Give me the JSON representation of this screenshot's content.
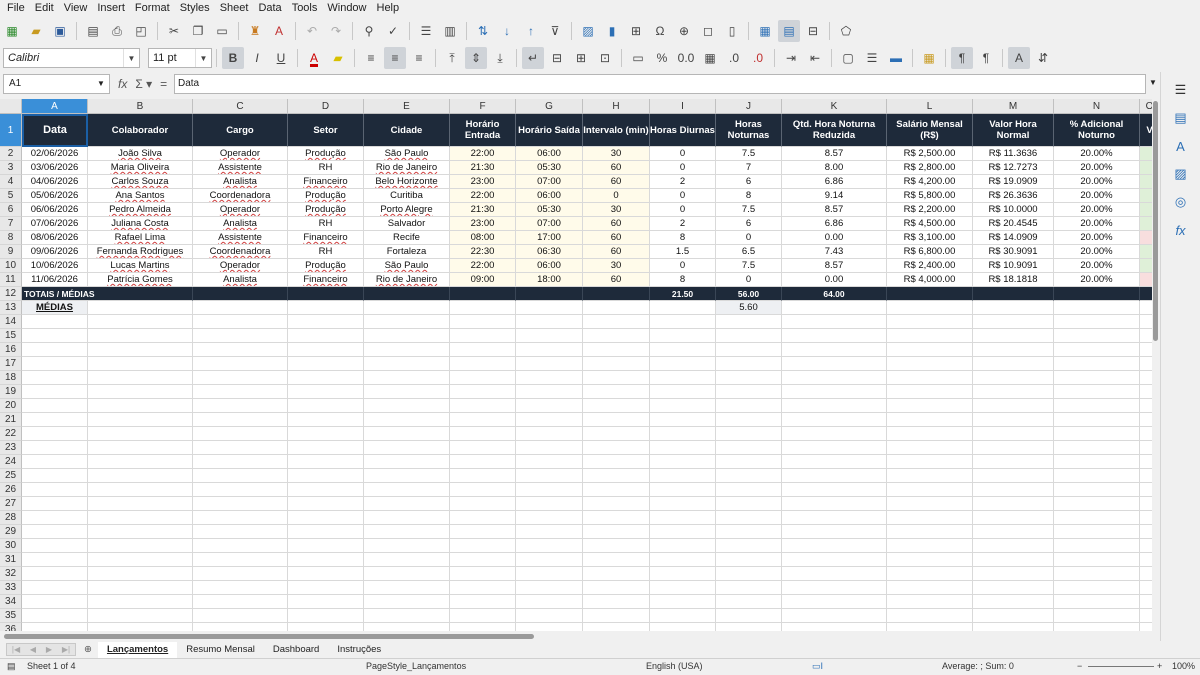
{
  "menu": [
    "File",
    "Edit",
    "View",
    "Insert",
    "Format",
    "Styles",
    "Sheet",
    "Data",
    "Tools",
    "Window",
    "Help"
  ],
  "font": {
    "name": "Calibri",
    "size": "11 pt"
  },
  "formula": {
    "cell_ref": "A1",
    "content": "Data"
  },
  "columns": [
    "A",
    "B",
    "C",
    "D",
    "E",
    "F",
    "G",
    "H",
    "I",
    "J",
    "K",
    "L",
    "M",
    "N",
    "O"
  ],
  "headers": [
    "Data",
    "Colaborador",
    "Cargo",
    "Setor",
    "Cidade",
    "Horário Entrada",
    "Horário Saída",
    "Intervalo (min)",
    "Horas Diurnas",
    "Horas Noturnas",
    "Qtd. Hora Noturna Reduzida",
    "Salário Mensal (R$)",
    "Valor Hora Normal",
    "% Adicional Noturno",
    "V"
  ],
  "rows": [
    [
      "02/06/2026",
      "João Silva",
      "Operador",
      "Produção",
      "São Paulo",
      "22:00",
      "06:00",
      "30",
      "0",
      "7.5",
      "8.57",
      "R$ 2,500.00",
      "R$ 11.3636",
      "20.00%"
    ],
    [
      "03/06/2026",
      "Maria Oliveira",
      "Assistente",
      "RH",
      "Rio de Janeiro",
      "21:30",
      "05:30",
      "60",
      "0",
      "7",
      "8.00",
      "R$ 2,800.00",
      "R$ 12.7273",
      "20.00%"
    ],
    [
      "04/06/2026",
      "Carlos Souza",
      "Analista",
      "Financeiro",
      "Belo Horizonte",
      "23:00",
      "07:00",
      "60",
      "2",
      "6",
      "6.86",
      "R$ 4,200.00",
      "R$ 19.0909",
      "20.00%"
    ],
    [
      "05/06/2026",
      "Ana Santos",
      "Coordenadora",
      "Produção",
      "Curitiba",
      "22:00",
      "06:00",
      "0",
      "0",
      "8",
      "9.14",
      "R$ 5,800.00",
      "R$ 26.3636",
      "20.00%"
    ],
    [
      "06/06/2026",
      "Pedro Almeida",
      "Operador",
      "Produção",
      "Porto Alegre",
      "21:30",
      "05:30",
      "30",
      "0",
      "7.5",
      "8.57",
      "R$ 2,200.00",
      "R$ 10.0000",
      "20.00%"
    ],
    [
      "07/06/2026",
      "Juliana Costa",
      "Analista",
      "RH",
      "Salvador",
      "23:00",
      "07:00",
      "60",
      "2",
      "6",
      "6.86",
      "R$ 4,500.00",
      "R$ 20.4545",
      "20.00%"
    ],
    [
      "08/06/2026",
      "Rafael Lima",
      "Assistente",
      "Financeiro",
      "Recife",
      "08:00",
      "17:00",
      "60",
      "8",
      "0",
      "0.00",
      "R$ 3,100.00",
      "R$ 14.0909",
      "20.00%"
    ],
    [
      "09/06/2026",
      "Fernanda Rodrigues",
      "Coordenadora",
      "RH",
      "Fortaleza",
      "22:30",
      "06:30",
      "60",
      "1.5",
      "6.5",
      "7.43",
      "R$ 6,800.00",
      "R$ 30.9091",
      "20.00%"
    ],
    [
      "10/06/2026",
      "Lucas Martins",
      "Operador",
      "Produção",
      "São Paulo",
      "22:00",
      "06:00",
      "30",
      "0",
      "7.5",
      "8.57",
      "R$ 2,400.00",
      "R$ 10.9091",
      "20.00%"
    ],
    [
      "11/06/2026",
      "Patrícia Gomes",
      "Analista",
      "Financeiro",
      "Rio de Janeiro",
      "09:00",
      "18:00",
      "60",
      "8",
      "0",
      "0.00",
      "R$ 4,000.00",
      "R$ 18.1818",
      "20.00%"
    ]
  ],
  "totals": {
    "label": "TOTAIS / MÉDIAS",
    "horas_diurnas": "21.50",
    "horas_noturnas": "56.00",
    "qtd_reduzida": "64.00"
  },
  "medias": {
    "label": "MÉDIAS",
    "horas_noturnas": "5.60"
  },
  "sheets": [
    "Lançamentos",
    "Resumo Mensal",
    "Dashboard",
    "Instruções"
  ],
  "status": {
    "sheet": "Sheet 1 of 4",
    "page_style": "PageStyle_Lançamentos",
    "language": "English (USA)",
    "summary": "Average: ; Sum: 0",
    "zoom": "100%"
  }
}
